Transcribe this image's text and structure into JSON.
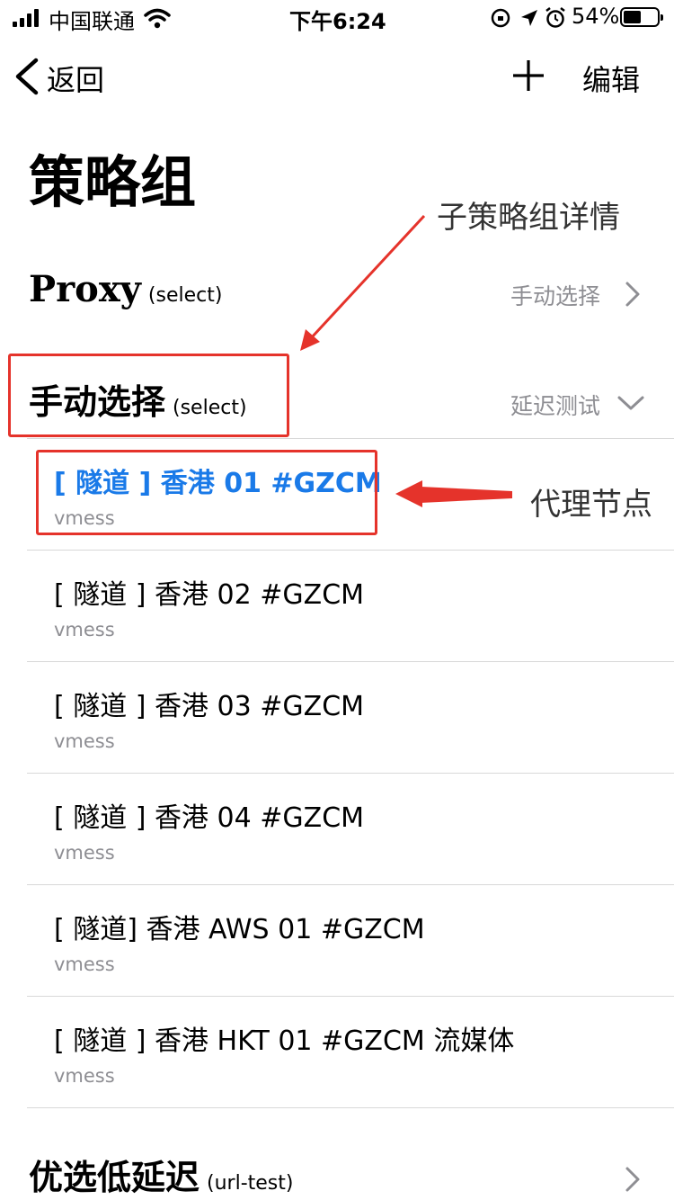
{
  "status_bar": {
    "carrier": "中国联通",
    "time": "下午6:24",
    "battery": "54%",
    "battery_level": 0.54
  },
  "nav": {
    "back_label": "返回",
    "edit_label": "编辑"
  },
  "page_title": "策略组",
  "groups": [
    {
      "name": "Proxy",
      "type": "(select)",
      "selected": "手动选择"
    },
    {
      "name": "手动选择",
      "type": "(select)",
      "selected": "延迟测试",
      "nodes": [
        {
          "name": "[ 隧道 ] 香港 01 #GZCM",
          "protocol": "vmess",
          "active": true
        },
        {
          "name": "[ 隧道 ] 香港 02  #GZCM",
          "protocol": "vmess"
        },
        {
          "name": "[ 隧道 ] 香港 03 #GZCM",
          "protocol": "vmess"
        },
        {
          "name": "[ 隧道 ] 香港 04 #GZCM",
          "protocol": "vmess"
        },
        {
          "name": "[ 隧道] 香港 AWS 01 #GZCM",
          "protocol": "vmess"
        },
        {
          "name": "[ 隧道 ] 香港 HKT 01 #GZCM 流媒体",
          "protocol": "vmess"
        }
      ]
    },
    {
      "name": "优选低延迟",
      "type": "(url-test)"
    }
  ],
  "annotations": {
    "sub_group_detail": "子策略组详情",
    "proxy_node": "代理节点",
    "color": "#e5332b"
  },
  "colors": {
    "accent": "#1a7ae8",
    "secondary_text": "#8e8e93"
  }
}
